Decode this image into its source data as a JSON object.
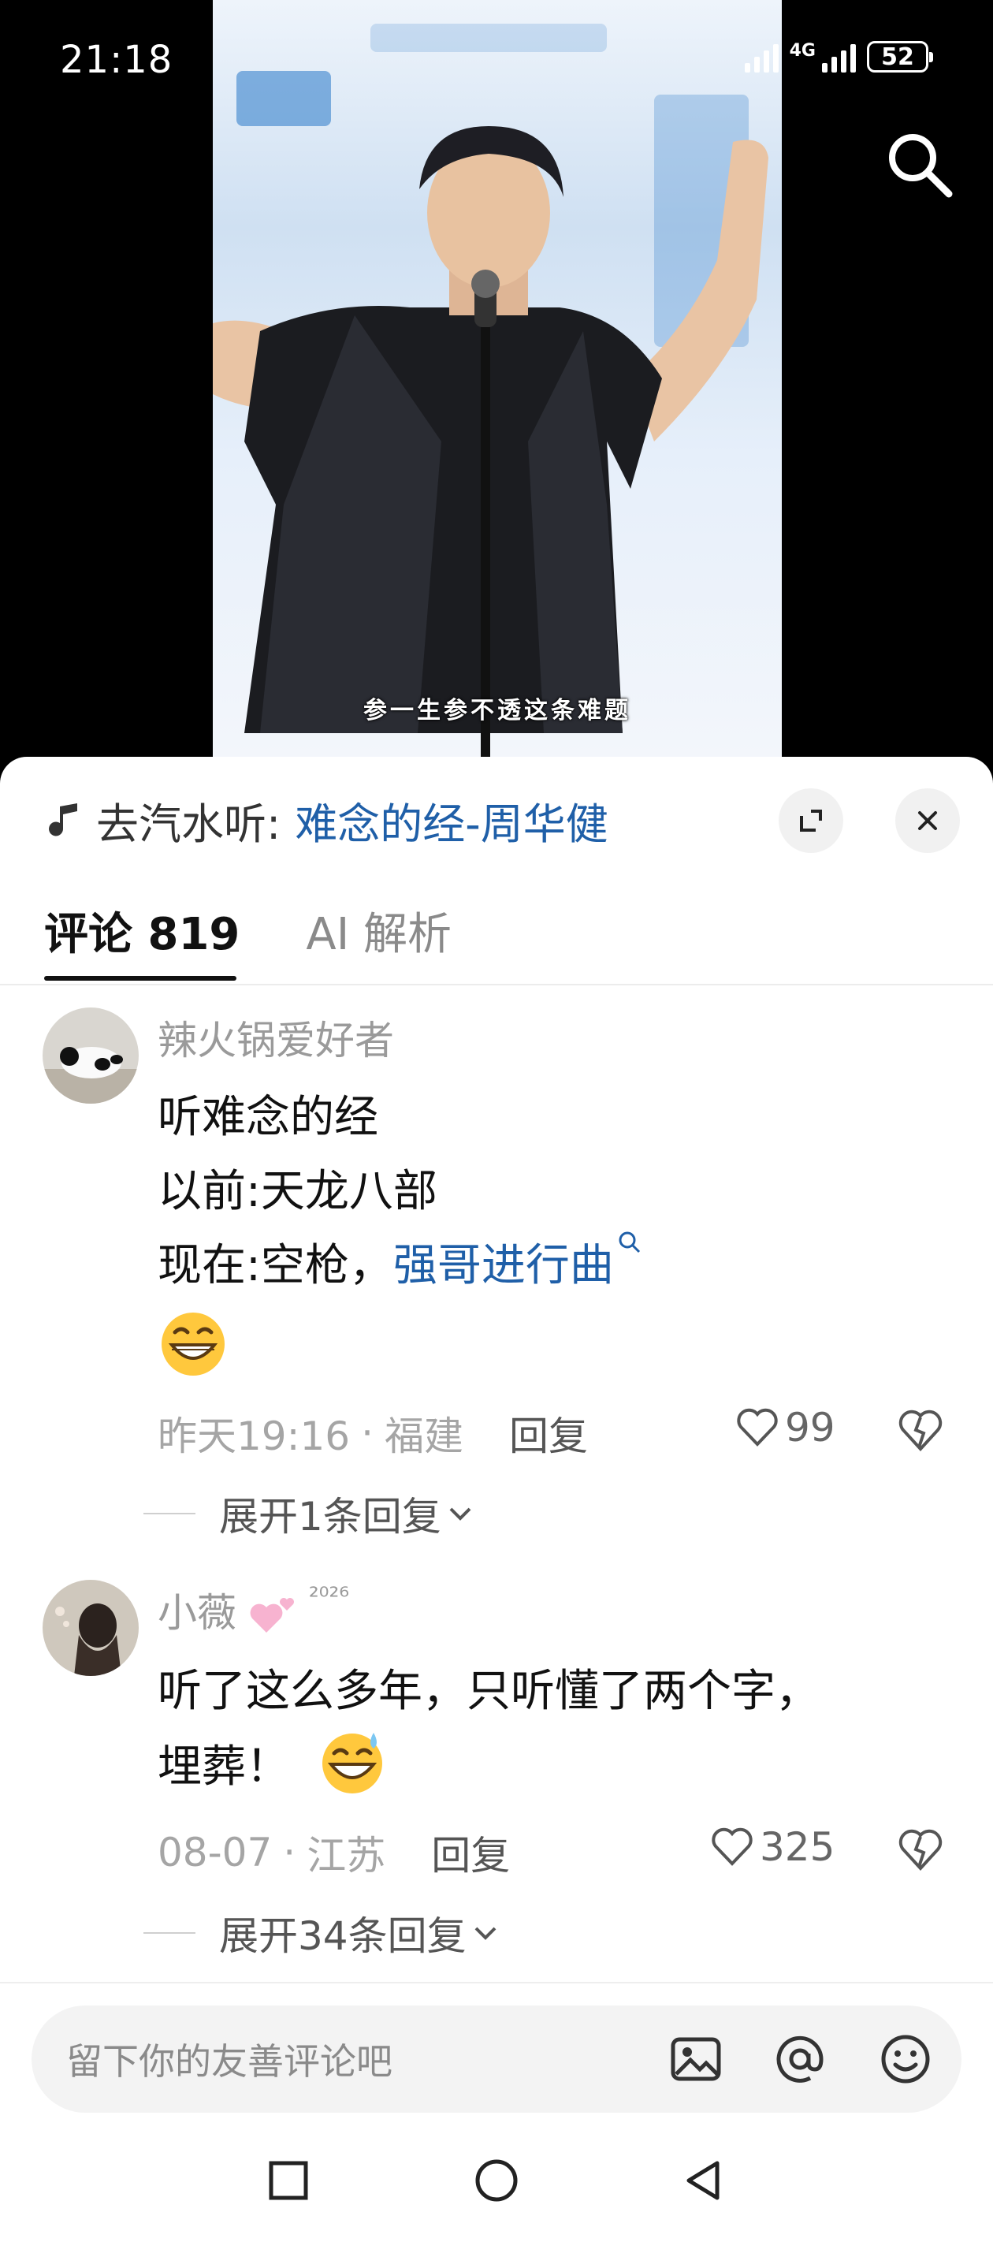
{
  "status_bar": {
    "time": "21:18",
    "network": "4G",
    "battery": "52"
  },
  "video": {
    "subtitle": "参一生参不透这条难题"
  },
  "music": {
    "prefix": "去汽水听:",
    "song": "难念的经-周华健"
  },
  "tabs": [
    {
      "label": "评论 819",
      "active": true
    },
    {
      "label": "AI 解析",
      "active": false
    }
  ],
  "comments": [
    {
      "user": "辣火锅爱好者",
      "lines": [
        "听难念的经",
        "以前:天龙八部",
        "现在:空枪，"
      ],
      "link": "强哥进行曲",
      "time": "昨天19:16",
      "location": "福建",
      "reply": "回复",
      "likes": "99",
      "expand": "展开1条回复"
    },
    {
      "user": "小薇",
      "user_badge": "²⁰²⁶",
      "lines": [
        "听了这么多年，只听懂了两个字，",
        "埋葬！"
      ],
      "time": "08-07",
      "location": "江苏",
      "reply": "回复",
      "likes": "325",
      "expand": "展开34条回复"
    }
  ],
  "input": {
    "placeholder": "留下你的友善评论吧"
  },
  "colors": {
    "link": "#1f5fa8",
    "meta": "#a5a5a5"
  }
}
